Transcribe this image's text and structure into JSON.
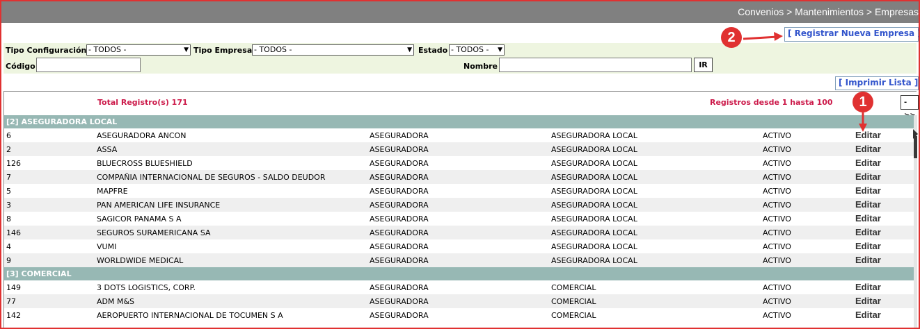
{
  "breadcrumb": "Convenios > Mantenimientos > Empresas",
  "actions": {
    "register": "[ Registrar Nueva Empresa ]",
    "print": "[ Imprimir Lista ]",
    "next": "->>"
  },
  "filters": {
    "tipo_configuracion": {
      "label": "Tipo Configuración",
      "value": "- TODOS -"
    },
    "tipo_empresa": {
      "label": "Tipo Empresa",
      "value": "- TODOS -"
    },
    "estado": {
      "label": "Estado",
      "value": "- TODOS -"
    },
    "codigo": {
      "label": "Código",
      "value": ""
    },
    "nombre": {
      "label": "Nombre",
      "value": ""
    },
    "ir": "IR"
  },
  "summary": {
    "total": "Total Registro(s) 171",
    "range": "Registros desde 1 hasta 100"
  },
  "edit_label": "Editar",
  "groups": [
    {
      "header": "[2] ASEGURADORA LOCAL",
      "rows": [
        {
          "id": "6",
          "name": "ASEGURADORA ANCON",
          "type": "ASEGURADORA",
          "config": "ASEGURADORA LOCAL",
          "status": "ACTIVO"
        },
        {
          "id": "2",
          "name": "ASSA",
          "type": "ASEGURADORA",
          "config": "ASEGURADORA LOCAL",
          "status": "ACTIVO"
        },
        {
          "id": "126",
          "name": "BLUECROSS BLUESHIELD",
          "type": "ASEGURADORA",
          "config": "ASEGURADORA LOCAL",
          "status": "ACTIVO"
        },
        {
          "id": "7",
          "name": "COMPAÑIA INTERNACIONAL DE SEGUROS - SALDO DEUDOR",
          "type": "ASEGURADORA",
          "config": "ASEGURADORA LOCAL",
          "status": "ACTIVO"
        },
        {
          "id": "5",
          "name": "MAPFRE",
          "type": "ASEGURADORA",
          "config": "ASEGURADORA LOCAL",
          "status": "ACTIVO"
        },
        {
          "id": "3",
          "name": "PAN AMERICAN LIFE INSURANCE",
          "type": "ASEGURADORA",
          "config": "ASEGURADORA LOCAL",
          "status": "ACTIVO"
        },
        {
          "id": "8",
          "name": "SAGICOR PANAMA S A",
          "type": "ASEGURADORA",
          "config": "ASEGURADORA LOCAL",
          "status": "ACTIVO"
        },
        {
          "id": "146",
          "name": "SEGUROS SURAMERICANA SA",
          "type": "ASEGURADORA",
          "config": "ASEGURADORA LOCAL",
          "status": "ACTIVO"
        },
        {
          "id": "4",
          "name": "VUMI",
          "type": "ASEGURADORA",
          "config": "ASEGURADORA LOCAL",
          "status": "ACTIVO"
        },
        {
          "id": "9",
          "name": "WORLDWIDE MEDICAL",
          "type": "ASEGURADORA",
          "config": "ASEGURADORA LOCAL",
          "status": "ACTIVO"
        }
      ]
    },
    {
      "header": "[3] COMERCIAL",
      "rows": [
        {
          "id": "149",
          "name": "3 DOTS LOGISTICS, CORP.",
          "type": "ASEGURADORA",
          "config": "COMERCIAL",
          "status": "ACTIVO"
        },
        {
          "id": "77",
          "name": "ADM M&S",
          "type": "ASEGURADORA",
          "config": "COMERCIAL",
          "status": "ACTIVO"
        },
        {
          "id": "142",
          "name": "AEROPUERTO INTERNACIONAL DE TOCUMEN S A",
          "type": "ASEGURADORA",
          "config": "COMERCIAL",
          "status": "ACTIVO"
        }
      ]
    }
  ],
  "annotations": {
    "badge1": "1",
    "badge2": "2",
    "color": "#e03131"
  }
}
